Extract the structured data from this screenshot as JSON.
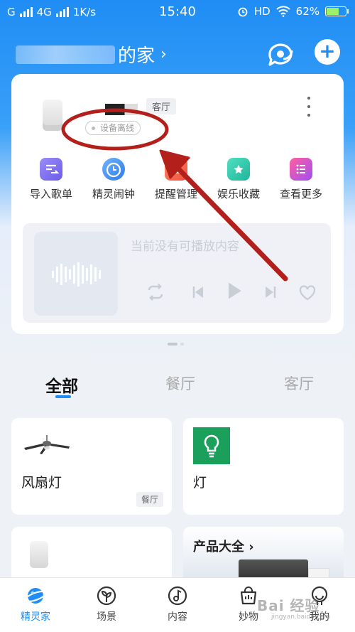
{
  "status_bar": {
    "carrier": "G",
    "network": "4G",
    "speed": "1K/s",
    "time": "15:40",
    "hd": "HD",
    "battery": "62%",
    "battery_level": 0.62
  },
  "header": {
    "home_suffix": "的家",
    "chevron": "›",
    "add_label": "+"
  },
  "device_card": {
    "room_tag": "客厅",
    "status": "设备离线",
    "quick_actions": [
      {
        "label": "导入歌单",
        "icon": "import-playlist-icon",
        "color": "#7a6bf2"
      },
      {
        "label": "精灵闹钟",
        "icon": "alarm-clock-icon",
        "color": "#3e8ef0"
      },
      {
        "label": "提醒管理",
        "icon": "reminder-icon",
        "color": "#f06a4d"
      },
      {
        "label": "娱乐收藏",
        "icon": "favorites-folder-icon",
        "color": "#2cc2a8"
      },
      {
        "label": "查看更多",
        "icon": "more-list-icon",
        "color": "#d24fd6"
      }
    ],
    "player": {
      "empty_text": "当前没有可播放内容"
    }
  },
  "tabs": [
    {
      "label": "全部",
      "active": true
    },
    {
      "label": "餐厅",
      "active": false
    },
    {
      "label": "客厅",
      "active": false
    }
  ],
  "devices": [
    {
      "name": "风扇灯",
      "room": "餐厅",
      "icon": "ceiling-fan-icon"
    },
    {
      "name": "灯",
      "room": "",
      "icon": "light-bulb-icon"
    },
    {
      "name": "",
      "room": "",
      "icon": "smart-speaker-icon"
    }
  ],
  "products": {
    "title": "产品大全",
    "chevron": "›"
  },
  "bottom_nav": [
    {
      "label": "精灵家",
      "icon": "planet-home-icon",
      "active": true
    },
    {
      "label": "场景",
      "icon": "scene-plant-icon",
      "active": false
    },
    {
      "label": "内容",
      "icon": "music-note-icon",
      "active": false
    },
    {
      "label": "妙物",
      "icon": "gift-bag-icon",
      "active": false
    },
    {
      "label": "我的",
      "icon": "profile-face-icon",
      "active": false
    }
  ],
  "watermark": {
    "text": "Bai 经验",
    "sub": "jingyan.baidu.com"
  },
  "colors": {
    "accent": "#1f8df5",
    "annotation": "#b3201c"
  }
}
